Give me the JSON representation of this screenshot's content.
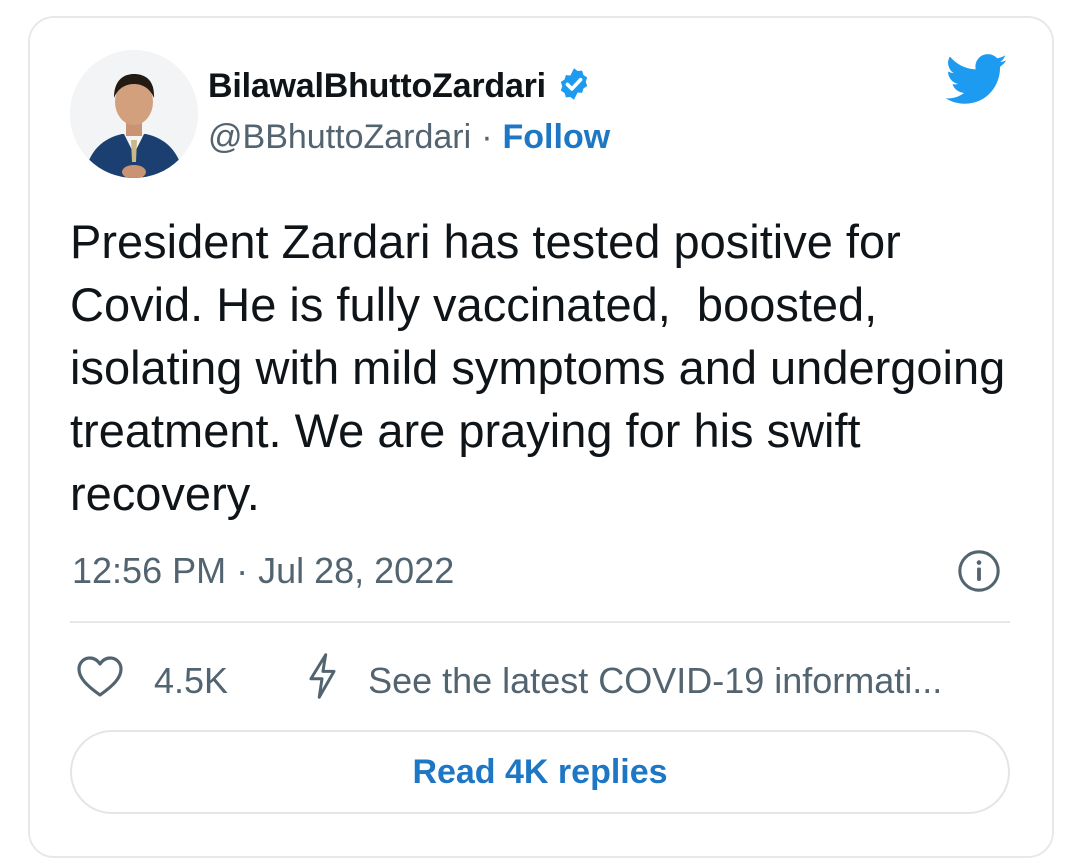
{
  "author": {
    "display_name": "BilawalBhuttoZardari",
    "handle": "@BBhuttoZardari",
    "separator": "·",
    "follow_label": "Follow",
    "verified_icon": "verified-badge-icon",
    "avatar": "profile-photo"
  },
  "brand": {
    "icon": "twitter-bird-icon",
    "color": "#1d9bf0"
  },
  "tweet": {
    "text": "President Zardari has tested positive for Covid. He is fully vaccinated,  boosted, isolating with mild symptoms and undergoing treatment. We are praying for his swift recovery.",
    "timestamp": "12:56 PM · Jul 28, 2022",
    "info_icon": "info-icon"
  },
  "actions": {
    "like_icon": "heart-icon",
    "like_count": "4.5K",
    "covid_icon": "lightning-bolt-icon",
    "covid_label": "See the latest COVID-19 informati..."
  },
  "replies_button_label": "Read 4K replies",
  "colors": {
    "accent": "#1d77c4",
    "text": "#0f1419",
    "muted": "#536471",
    "border": "#e6e9ec"
  }
}
